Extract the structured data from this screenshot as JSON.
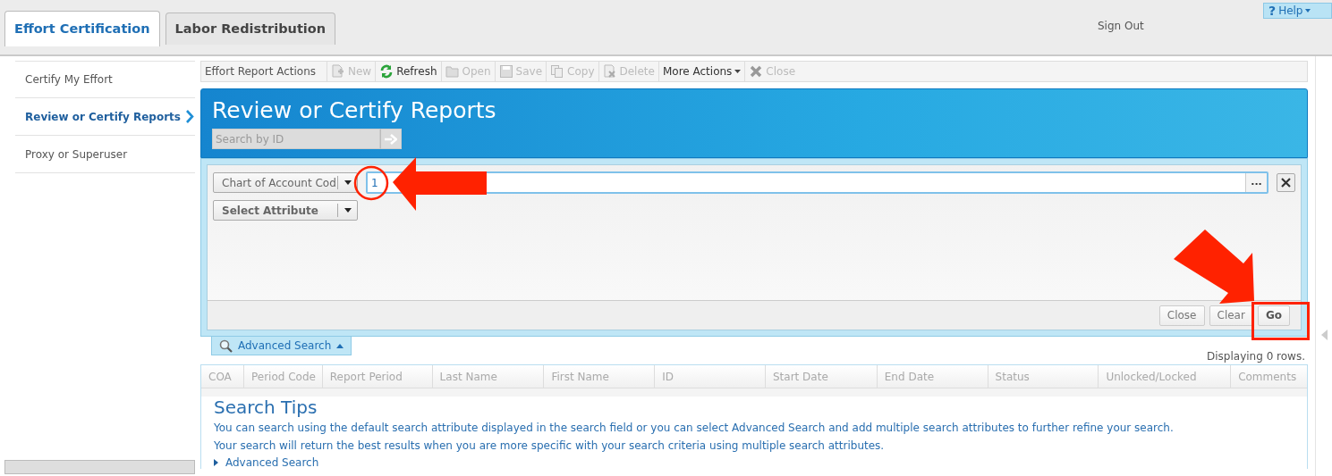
{
  "tabs": [
    {
      "label": "Effort Certification",
      "selected": true
    },
    {
      "label": "Labor Redistribution",
      "selected": false
    }
  ],
  "header": {
    "sign_out": "Sign Out",
    "help_icon": "?",
    "help": "Help"
  },
  "sidebar": {
    "items": [
      {
        "label": "Certify My Effort",
        "selected": false
      },
      {
        "label": "Review or Certify Reports",
        "selected": true
      },
      {
        "label": "Proxy or Superuser",
        "selected": false
      }
    ]
  },
  "toolbar": {
    "title": "Effort Report Actions",
    "actions": [
      {
        "kind": "new",
        "label": "New",
        "disabled": true
      },
      {
        "kind": "refresh",
        "label": "Refresh",
        "disabled": false
      },
      {
        "kind": "open",
        "label": "Open",
        "disabled": true
      },
      {
        "kind": "save",
        "label": "Save",
        "disabled": true
      },
      {
        "kind": "copy",
        "label": "Copy",
        "disabled": true
      },
      {
        "kind": "delete",
        "label": "Delete",
        "disabled": true
      },
      {
        "kind": "menu",
        "label": "More Actions",
        "disabled": false
      },
      {
        "kind": "close",
        "label": "Close",
        "disabled": true
      }
    ]
  },
  "banner": {
    "title": "Review or Certify Reports",
    "search_placeholder": "Search by ID"
  },
  "search_panel": {
    "criteria": [
      {
        "attribute": "Chart of Account Cod",
        "value": "1"
      }
    ],
    "add_attribute": "Select Attribute",
    "lookup": "...",
    "buttons": [
      "Close",
      "Clear",
      "Go"
    ]
  },
  "advanced_search_tab": {
    "label": "Advanced Search",
    "expanded": true
  },
  "results": {
    "count": "Displaying 0 rows.",
    "columns": [
      "COA",
      "Period Code",
      "Report Period",
      "Last Name",
      "First Name",
      "ID",
      "Start Date",
      "End Date",
      "Status",
      "Unlocked/Locked",
      "Comments"
    ]
  },
  "search_tips": {
    "title": "Search Tips",
    "paragraphs": [
      "You can search using the default search attribute displayed in the search field or you can select Advanced Search and add multiple search attributes to further refine your search.",
      "Your search will return the best results when you are more specific with your search criteria using multiple search attributes."
    ],
    "link": "Advanced Search"
  }
}
